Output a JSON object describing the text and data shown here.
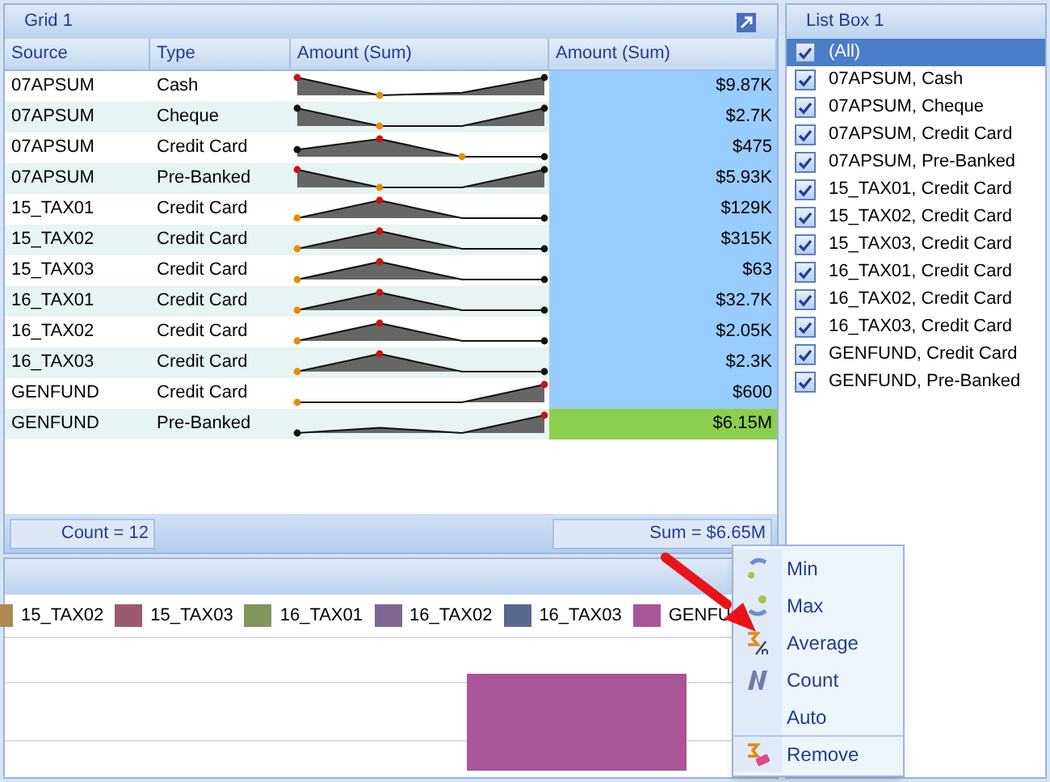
{
  "grid": {
    "title": "Grid 1",
    "columns": [
      "Source",
      "Type",
      "Amount (Sum)",
      "Amount (Sum)"
    ],
    "rows": [
      {
        "source": "07APSUM",
        "type": "Cash",
        "amount": "$9.87K",
        "color": "#99ccff"
      },
      {
        "source": "07APSUM",
        "type": "Cheque",
        "amount": "$2.7K",
        "color": "#99ccff"
      },
      {
        "source": "07APSUM",
        "type": "Credit Card",
        "amount": "$475",
        "color": "#99ccff"
      },
      {
        "source": "07APSUM",
        "type": "Pre-Banked",
        "amount": "$5.93K",
        "color": "#99ccff"
      },
      {
        "source": "15_TAX01",
        "type": "Credit Card",
        "amount": "$129K",
        "color": "#99ccff"
      },
      {
        "source": "15_TAX02",
        "type": "Credit Card",
        "amount": "$315K",
        "color": "#99ccff"
      },
      {
        "source": "15_TAX03",
        "type": "Credit Card",
        "amount": "$63",
        "color": "#99ccff"
      },
      {
        "source": "16_TAX01",
        "type": "Credit Card",
        "amount": "$32.7K",
        "color": "#99ccff"
      },
      {
        "source": "16_TAX02",
        "type": "Credit Card",
        "amount": "$2.05K",
        "color": "#99ccff"
      },
      {
        "source": "16_TAX03",
        "type": "Credit Card",
        "amount": "$2.3K",
        "color": "#99ccff"
      },
      {
        "source": "GENFUND",
        "type": "Credit Card",
        "amount": "$600",
        "color": "#99ccff"
      },
      {
        "source": "GENFUND",
        "type": "Pre-Banked",
        "amount": "$6.15M",
        "color": "#8ccf4f"
      }
    ],
    "footer": {
      "count": "Count = 12",
      "sum": "Sum = $6.65M"
    }
  },
  "chart_panel": {
    "legend": [
      {
        "label": "15_TAX02",
        "color": "#b08850"
      },
      {
        "label": "15_TAX03",
        "color": "#9a5a6e"
      },
      {
        "label": "16_TAX01",
        "color": "#82955e"
      },
      {
        "label": "16_TAX02",
        "color": "#7e6690"
      },
      {
        "label": "16_TAX03",
        "color": "#5a6890"
      },
      {
        "label": "GENFU",
        "color": "#a9559a"
      }
    ]
  },
  "list_box": {
    "title": "List Box 1",
    "items": [
      {
        "label": "(All)",
        "checked": true,
        "selected": true
      },
      {
        "label": "07APSUM, Cash",
        "checked": true,
        "selected": false
      },
      {
        "label": "07APSUM, Cheque",
        "checked": true,
        "selected": false
      },
      {
        "label": "07APSUM, Credit Card",
        "checked": true,
        "selected": false
      },
      {
        "label": "07APSUM, Pre-Banked",
        "checked": true,
        "selected": false
      },
      {
        "label": "15_TAX01, Credit Card",
        "checked": true,
        "selected": false
      },
      {
        "label": "15_TAX02, Credit Card",
        "checked": true,
        "selected": false
      },
      {
        "label": "15_TAX03, Credit Card",
        "checked": true,
        "selected": false
      },
      {
        "label": "16_TAX01, Credit Card",
        "checked": true,
        "selected": false
      },
      {
        "label": "16_TAX02, Credit Card",
        "checked": true,
        "selected": false
      },
      {
        "label": "16_TAX03, Credit Card",
        "checked": true,
        "selected": false
      },
      {
        "label": "GENFUND, Credit Card",
        "checked": true,
        "selected": false
      },
      {
        "label": "GENFUND, Pre-Banked",
        "checked": true,
        "selected": false
      }
    ]
  },
  "context_menu": {
    "items": [
      {
        "label": "Min",
        "separator": false
      },
      {
        "label": "Max",
        "separator": false
      },
      {
        "label": "Average",
        "separator": false
      },
      {
        "label": "Count",
        "separator": false
      },
      {
        "label": "Auto",
        "separator": false
      },
      {
        "label": "Remove",
        "separator": true
      }
    ]
  }
}
